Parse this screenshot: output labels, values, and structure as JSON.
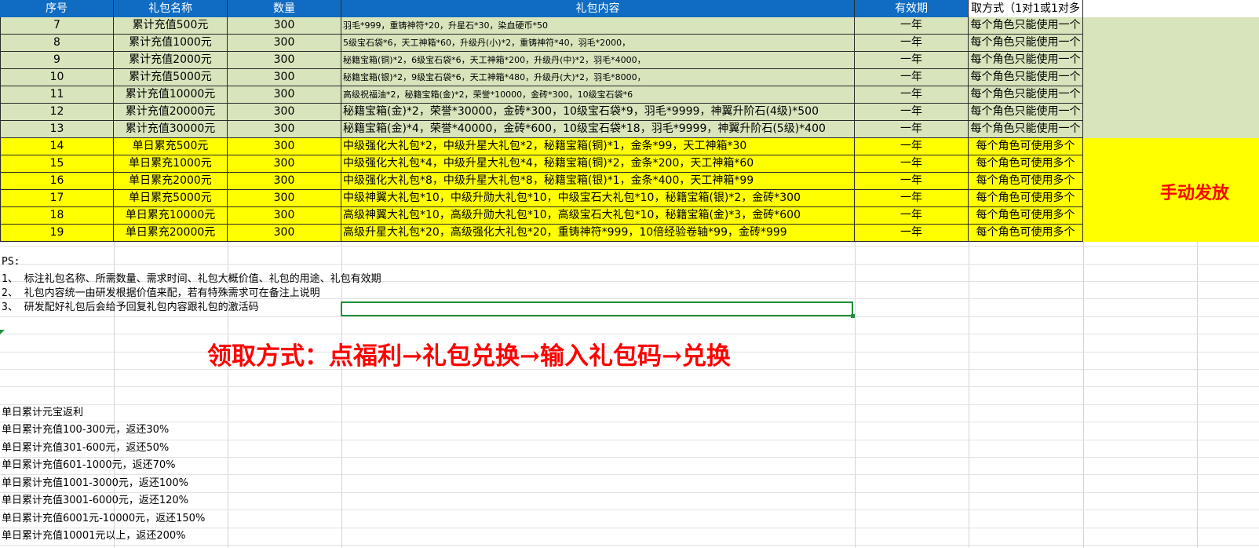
{
  "headers": [
    "序号",
    "礼包名称",
    "数量",
    "礼包内容",
    "有效期",
    "取方式（1对1或1对多"
  ],
  "rows": [
    {
      "id": "7",
      "name": "累计充值500元",
      "qty": "300",
      "content": "羽毛*999，重铸神符*20，升星石*30，染血硬币*50",
      "valid": "一年",
      "method": "每个角色只能使用一个",
      "style": "green",
      "small": true
    },
    {
      "id": "8",
      "name": "累计充值1000元",
      "qty": "300",
      "content": "5级宝石袋*6，天工神箱*60，升级丹(小)*2，重铸神符*40，羽毛*2000，",
      "valid": "一年",
      "method": "每个角色只能使用一个",
      "style": "green",
      "small": true
    },
    {
      "id": "9",
      "name": "累计充值2000元",
      "qty": "300",
      "content": "秘籍宝箱(铜)*2，6级宝石袋*6，天工神箱*200，升级丹(中)*2，羽毛*4000，",
      "valid": "一年",
      "method": "每个角色只能使用一个",
      "style": "green",
      "small": true
    },
    {
      "id": "10",
      "name": "累计充值5000元",
      "qty": "300",
      "content": "秘籍宝箱(银)*2，9级宝石袋*6，天工神箱*480，升级丹(大)*2，羽毛*8000，",
      "valid": "一年",
      "method": "每个角色只能使用一个",
      "style": "green",
      "small": true
    },
    {
      "id": "11",
      "name": "累计充值10000元",
      "qty": "300",
      "content": "高级祝福油*2，秘籍宝箱(金)*2，荣誉*10000，金砖*300，10级宝石袋*6",
      "valid": "一年",
      "method": "每个角色只能使用一个",
      "style": "green",
      "small": true
    },
    {
      "id": "12",
      "name": "累计充值20000元",
      "qty": "300",
      "content": "秘籍宝箱(金)*2，荣誉*30000，金砖*300，10级宝石袋*9，羽毛*9999，神翼升阶石(4级)*500",
      "valid": "一年",
      "method": "每个角色只能使用一个",
      "style": "green",
      "small": false
    },
    {
      "id": "13",
      "name": "累计充值30000元",
      "qty": "300",
      "content": "秘籍宝箱(金)*4，荣誉*40000，金砖*600，10级宝石袋*18，羽毛*9999，神翼升阶石(5级)*400",
      "valid": "一年",
      "method": "每个角色只能使用一个",
      "style": "green",
      "small": false
    },
    {
      "id": "14",
      "name": "单日累充500元",
      "qty": "300",
      "content": "中级强化大礼包*2，中级升星大礼包*2，秘籍宝箱(铜)*1，金条*99，天工神箱*30",
      "valid": "一年",
      "method": "每个角色可使用多个",
      "style": "yellow",
      "small": false
    },
    {
      "id": "15",
      "name": "单日累充1000元",
      "qty": "300",
      "content": "中级强化大礼包*4，中级升星大礼包*4，秘籍宝箱(铜)*2，金条*200，天工神箱*60",
      "valid": "一年",
      "method": "每个角色可使用多个",
      "style": "yellow",
      "small": false
    },
    {
      "id": "16",
      "name": "单日累充2000元",
      "qty": "300",
      "content": "中级强化大礼包*8，中级升星大礼包*8，秘籍宝箱(银)*1，金条*400，天工神箱*99",
      "valid": "一年",
      "method": "每个角色可使用多个",
      "style": "yellow",
      "small": false
    },
    {
      "id": "17",
      "name": "单日累充5000元",
      "qty": "300",
      "content": "中级神翼大礼包*10，中级升勋大礼包*10，中级宝石大礼包*10，秘籍宝箱(银)*2，金砖*300",
      "valid": "一年",
      "method": "每个角色可使用多个",
      "style": "yellow",
      "small": false
    },
    {
      "id": "18",
      "name": "单日累充10000元",
      "qty": "300",
      "content": "高级神翼大礼包*10，高级升勋大礼包*10，高级宝石大礼包*10，秘籍宝箱(金)*3，金砖*600",
      "valid": "一年",
      "method": "每个角色可使用多个",
      "style": "yellow",
      "small": false
    },
    {
      "id": "19",
      "name": "单日累充20000元",
      "qty": "300",
      "content": "高级升星大礼包*20，高级强化大礼包*20，重铸神符*999，10倍经验卷轴*99，金砖*999",
      "valid": "一年",
      "method": "每个角色可使用多个",
      "style": "yellow",
      "small": false
    }
  ],
  "manual_label": "手动发放",
  "notes": [
    "PS:",
    "1、 标注礼包名称、所需数量、需求时间、礼包大概价值、礼包的用途、礼包有效期",
    "2、 礼包内容统一由研发根据价值来配，若有特殊需求可在备注上说明",
    "3、 研发配好礼包后会给予回复礼包内容跟礼包的激活码"
  ],
  "claim_method": "领取方式：点福利→礼包兑换→输入礼包码→兑换",
  "rebate": [
    "单日累计元宝返利",
    "单日累计充值100-300元，返还30%",
    "单日累计充值301-600元，返还50%",
    "单日累计充值601-1000元，返还70%",
    "单日累计充值1001-3000元，返还100%",
    "单日累计充值3001-6000元，返还120%",
    "单日累计充值6001元-10000元，返还150%",
    "单日累计充值10001元以上，返还200%"
  ],
  "colors": {
    "header": "#0f6cc2",
    "green_row": "#d8e4bc",
    "yellow_row": "#ffff00",
    "accent_red": "#ff0000",
    "selection": "#1f8f3a"
  }
}
